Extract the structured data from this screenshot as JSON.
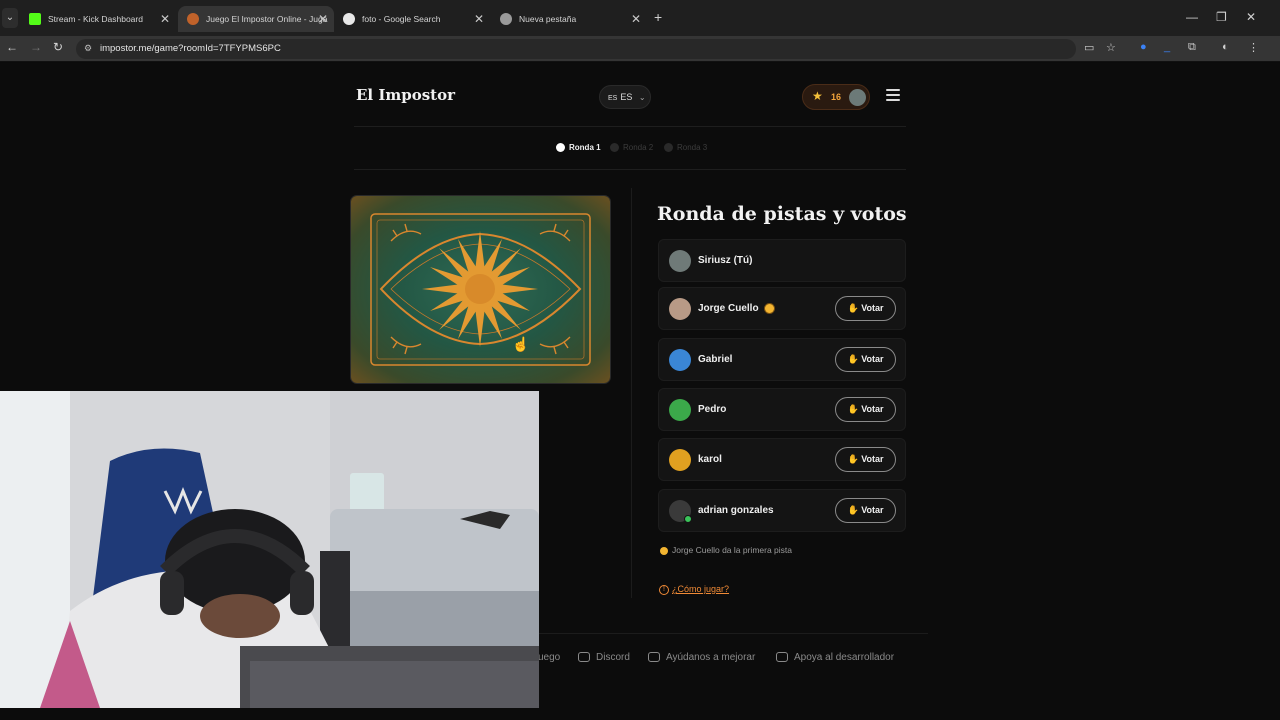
{
  "browser": {
    "tabs": [
      {
        "title": "Stream - Kick Dashboard",
        "active": false,
        "favicon": "kick-icon"
      },
      {
        "title": "Juego El Impostor Online - Juga",
        "active": true,
        "favicon": "impostor-icon"
      },
      {
        "title": "foto - Google Search",
        "active": false,
        "favicon": "google-icon"
      },
      {
        "title": "Nueva pestaña",
        "active": false,
        "favicon": "chrome-icon"
      }
    ],
    "url": "impostor.me/game?roomId=7TFYPMS6PC"
  },
  "header": {
    "brand": "El Impostor",
    "lang_code": "ES",
    "lang_label": "ES",
    "score": "16"
  },
  "rounds": [
    "Ronda 1",
    "Ronda 2",
    "Ronda 3"
  ],
  "section_title": "Ronda de pistas y votos",
  "players": [
    {
      "name": "Siriusz (Tú)",
      "vote": ""
    },
    {
      "name": "Jorge Cuello",
      "vote": "Votar"
    },
    {
      "name": "Gabriel",
      "vote": "Votar"
    },
    {
      "name": "Pedro",
      "vote": "Votar"
    },
    {
      "name": "karol",
      "vote": "Votar"
    },
    {
      "name": "adrian gonzales",
      "vote": "Votar"
    }
  ],
  "hint": "Jorge Cuello da la primera pista",
  "howto": "¿Cómo jugar?",
  "footer": [
    "uego",
    "Discord",
    "Ayúdanos a mejorar",
    "Apoya al desarrollador"
  ],
  "colors": {
    "accent": "#f08a36",
    "badge": "#f3b531",
    "online": "#3ac45a"
  }
}
